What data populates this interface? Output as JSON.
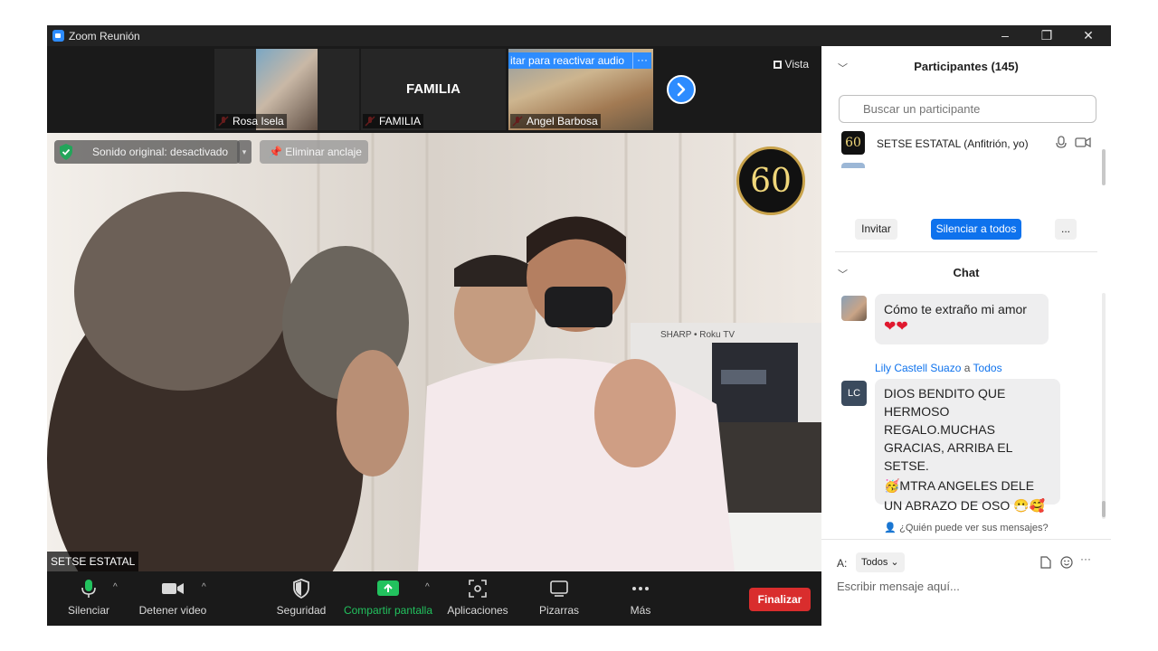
{
  "window": {
    "title": "Zoom Reunión",
    "controls": [
      "–",
      "❐",
      "✕"
    ]
  },
  "strip": {
    "participants": [
      {
        "name": "Rosa Isela"
      },
      {
        "name": "FAMILIA",
        "center_label": "FAMILIA"
      },
      {
        "name": "Angel Barbosa",
        "banner": "itar para reactivar audio",
        "banner_more": "···"
      }
    ],
    "view_label": "Vista"
  },
  "main_video": {
    "original_sound": "Sonido original: desactivado",
    "unpin": "Eliminar anclaje",
    "speaker_name": "SETSE ESTATAL",
    "badge_number": "60",
    "tv_brand": "SHARP • Roku TV"
  },
  "controls": {
    "mute": "Silenciar",
    "video": "Detener video",
    "security": "Seguridad",
    "share": "Compartir pantalla",
    "apps": "Aplicaciones",
    "whiteboards": "Pizarras",
    "more": "Más",
    "end": "Finalizar",
    "share_color": "#22c25e",
    "end_color": "#d92d2d"
  },
  "participants_panel": {
    "title": "Participantes (145)",
    "search_placeholder": "Buscar un participante",
    "host_name": "SETSE ESTATAL (Anfitrión, yo)",
    "host_avatar": "60",
    "invite": "Invitar",
    "mute_all": "Silenciar a todos",
    "more": "..."
  },
  "chat": {
    "title": "Chat",
    "messages": [
      {
        "text": "Cómo te extraño mi amor",
        "emoji": "❤❤"
      },
      {
        "sender": "Lily Castell Suazo",
        "connector": "a",
        "recipient": "Todos",
        "initials": "LC",
        "lines": [
          "DIOS BENDITO QUE",
          "HERMOSO",
          "REGALO.MUCHAS",
          "GRACIAS, ARRIBA EL SETSE.",
          "🥳MTRA ANGELES DELE",
          "UN ABRAZO DE OSO 😷🥰"
        ]
      }
    ],
    "who_can_see": "¿Quién puede ver sus mensajes?",
    "to_label": "A:",
    "to_value": "Todos",
    "input_placeholder": "Escribir mensaje aquí..."
  }
}
